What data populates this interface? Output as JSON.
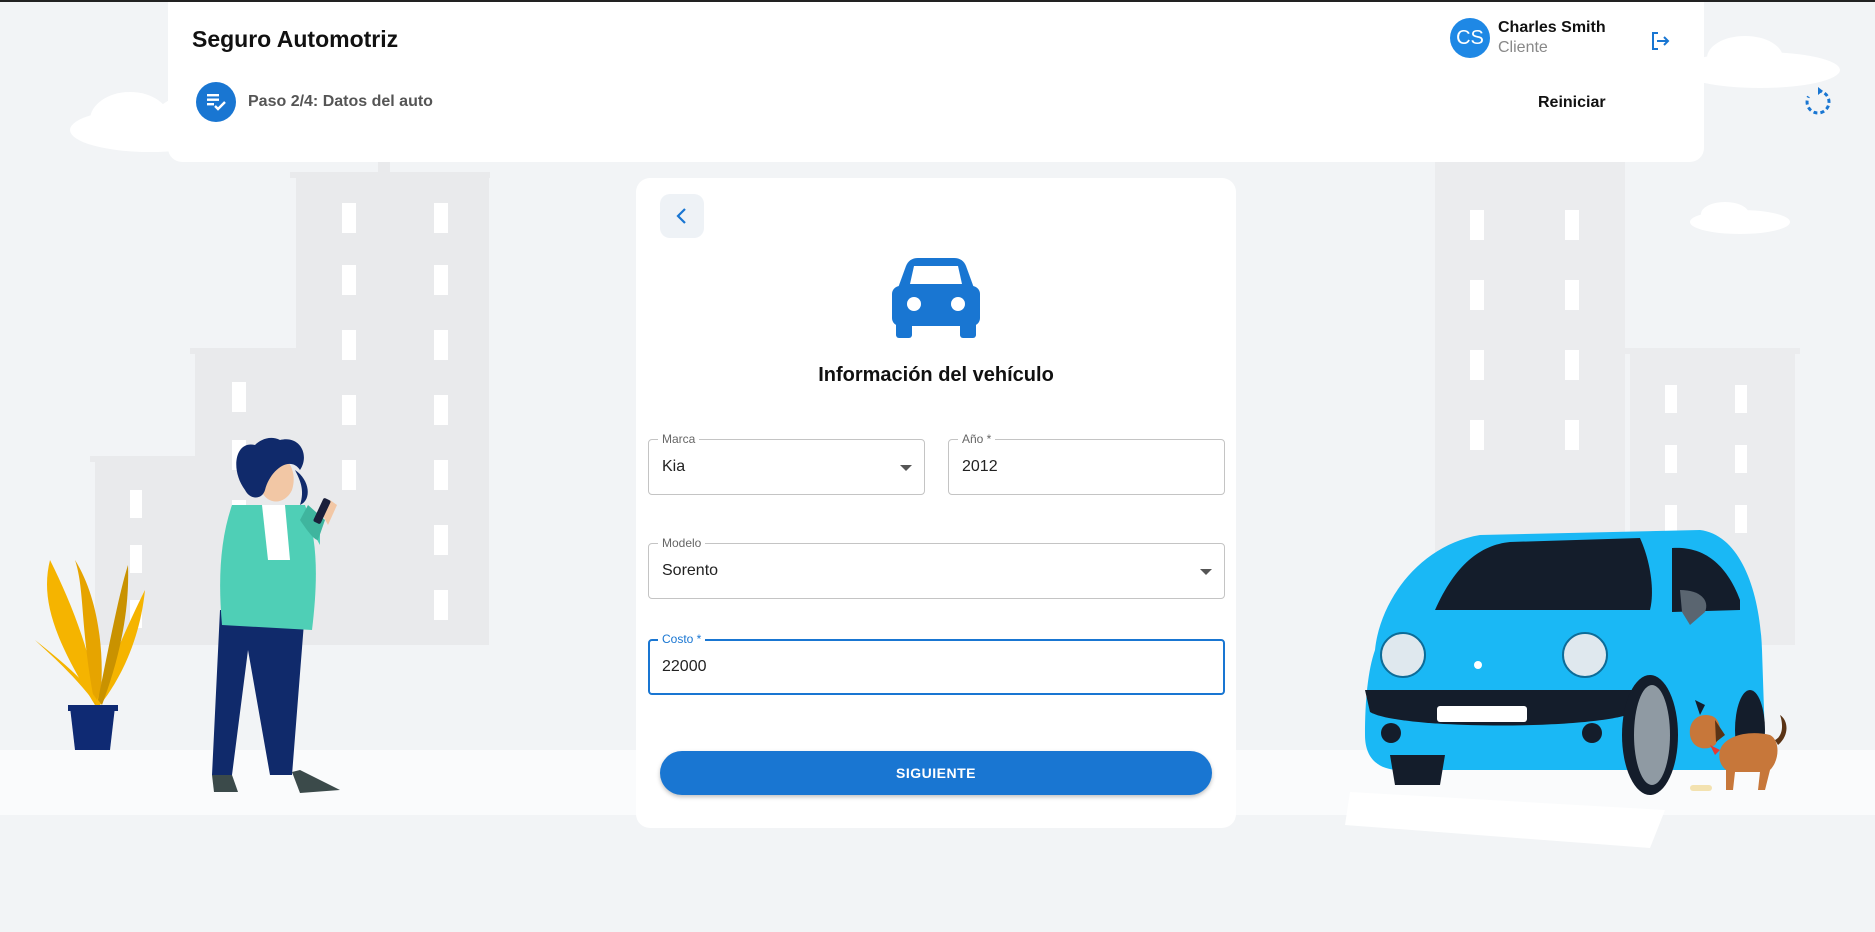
{
  "header": {
    "app_title": "Seguro Automotriz",
    "step_label": "Paso 2/4: Datos del auto",
    "user": {
      "initials": "CS",
      "name": "Charles Smith",
      "role": "Cliente"
    },
    "reset_label": "Reiniciar",
    "icons": {
      "step": "checklist-icon",
      "logout": "logout-icon",
      "reset": "restart-icon"
    }
  },
  "form": {
    "title": "Información del vehículo",
    "icon": "car-icon",
    "back_icon": "chevron-left-icon",
    "fields": {
      "marca": {
        "label": "Marca",
        "value": "Kia"
      },
      "anio": {
        "label": "Año *",
        "value": "2012"
      },
      "modelo": {
        "label": "Modelo",
        "value": "Sorento"
      },
      "costo": {
        "label": "Costo *",
        "value": "22000"
      }
    },
    "submit_label": "SIGUIENTE"
  },
  "colors": {
    "primary": "#1976d2",
    "background": "#f2f4f6",
    "car_blue": "#1ab8f5"
  }
}
